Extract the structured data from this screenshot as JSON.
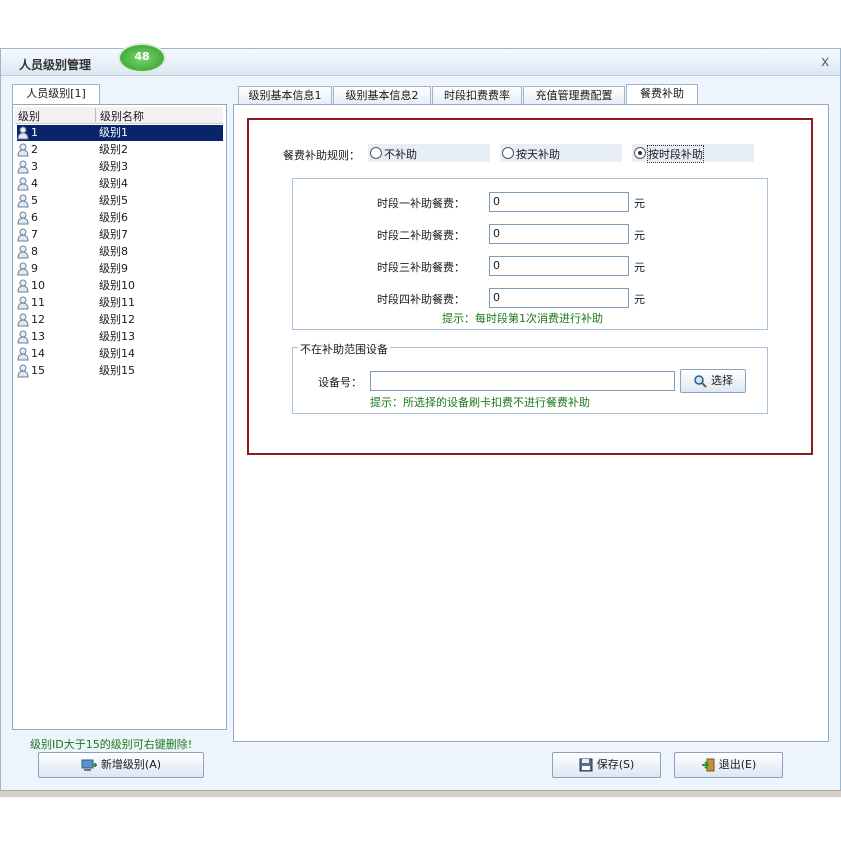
{
  "window": {
    "title": "人员级别管理",
    "badge": "48",
    "close_label": "x"
  },
  "left": {
    "tab_label": "人员级别[1]",
    "columns": [
      "级别",
      "级别名称"
    ],
    "rows": [
      {
        "id": "1",
        "name": "级别1",
        "selected": true
      },
      {
        "id": "2",
        "name": "级别2"
      },
      {
        "id": "3",
        "name": "级别3"
      },
      {
        "id": "4",
        "name": "级别4"
      },
      {
        "id": "5",
        "name": "级别5"
      },
      {
        "id": "6",
        "name": "级别6"
      },
      {
        "id": "7",
        "name": "级别7"
      },
      {
        "id": "8",
        "name": "级别8"
      },
      {
        "id": "9",
        "name": "级别9"
      },
      {
        "id": "10",
        "name": "级别10"
      },
      {
        "id": "11",
        "name": "级别11"
      },
      {
        "id": "12",
        "name": "级别12"
      },
      {
        "id": "13",
        "name": "级别13"
      },
      {
        "id": "14",
        "name": "级别14"
      },
      {
        "id": "15",
        "name": "级别15"
      }
    ],
    "footer_hint": "级别ID大于15的级别可右键删除!",
    "add_button": "新增级别(A)"
  },
  "tabs": [
    "级别基本信息1",
    "级别基本信息2",
    "时段扣费费率",
    "充值管理费配置",
    "餐费补助"
  ],
  "active_tab": "餐费补助",
  "meal": {
    "rule_label": "餐费补助规则：",
    "options": [
      "不补助",
      "按天补助",
      "按时段补助"
    ],
    "selected_option": "按时段补助",
    "periods": [
      {
        "label": "时段一补助餐费：",
        "value": "0",
        "unit": "元"
      },
      {
        "label": "时段二补助餐费：",
        "value": "0",
        "unit": "元"
      },
      {
        "label": "时段三补助餐费：",
        "value": "0",
        "unit": "元"
      },
      {
        "label": "时段四补助餐费：",
        "value": "0",
        "unit": "元"
      }
    ],
    "period_hint": "提示：每时段第1次消费进行补助",
    "exclude_group_title": "不在补助范围设备",
    "device_label": "设备号：",
    "device_value": "",
    "select_button": "选择",
    "device_hint": "提示：所选择的设备刷卡扣费不进行餐费补助"
  },
  "buttons": {
    "save": "保存(S)",
    "exit": "退出(E)"
  },
  "colors": {
    "selection": "#0a246a",
    "hint_green": "#1a7a1a",
    "frame_red": "#8b1a1a"
  }
}
